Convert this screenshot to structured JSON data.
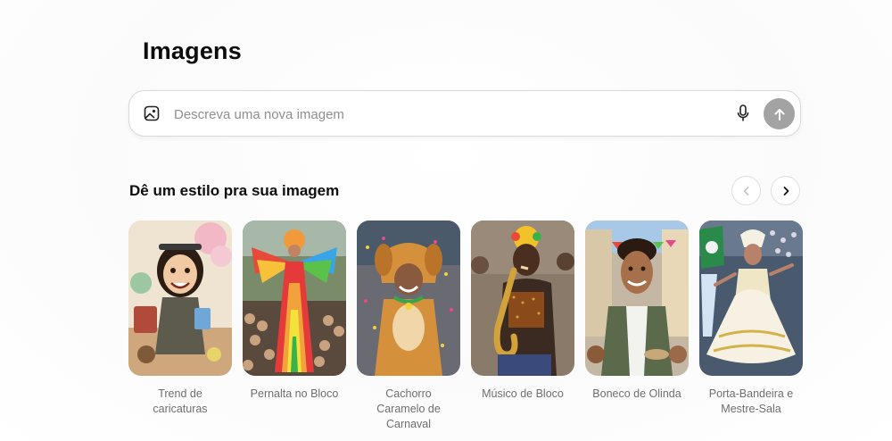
{
  "page": {
    "title": "Imagens"
  },
  "composer": {
    "placeholder": "Descreva uma nova imagem",
    "value": "",
    "image_icon": "image-upload-icon",
    "mic_icon": "microphone-icon",
    "send_icon": "arrow-up-icon"
  },
  "styles": {
    "heading": "Dê um estilo pra sua imagem",
    "prev_icon": "chevron-left-icon",
    "next_icon": "chevron-right-icon",
    "items": [
      {
        "label": "Trend de caricaturas"
      },
      {
        "label": "Pernalta no Bloco"
      },
      {
        "label": "Cachorro Caramelo de Carnaval"
      },
      {
        "label": "Músico de Bloco"
      },
      {
        "label": "Boneco de Olinda"
      },
      {
        "label": "Porta-Bandeira e Mestre-Sala"
      }
    ]
  },
  "colors": {
    "send_button": "#a3a3a3",
    "caption_text": "#6e6e6e",
    "border": "#d9d9d9"
  }
}
